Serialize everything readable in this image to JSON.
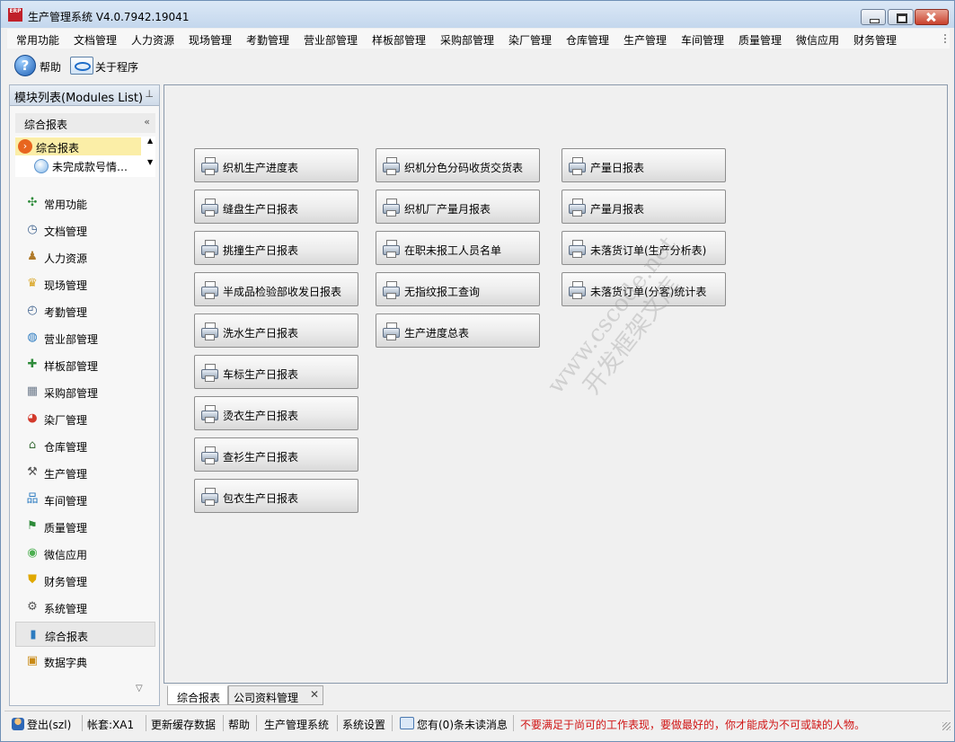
{
  "window": {
    "title": "生产管理系统 V4.0.7942.19041",
    "logo_text": "ERP"
  },
  "menu": [
    "常用功能",
    "文档管理",
    "人力资源",
    "现场管理",
    "考勤管理",
    "营业部管理",
    "样板部管理",
    "采购部管理",
    "染厂管理",
    "仓库管理",
    "生产管理",
    "车间管理",
    "质量管理",
    "微信应用",
    "财务管理"
  ],
  "toolbar": {
    "help": "帮助",
    "about": "关于程序"
  },
  "sidebar": {
    "title": "模块列表(Modules List)",
    "pin": "ᵖ",
    "group_title": "综合报表",
    "tree": [
      {
        "label": "综合报表",
        "selected": true
      },
      {
        "label": "未完成款号情…",
        "selected": false
      }
    ],
    "nav": [
      {
        "label": "常用功能",
        "icon": "expand-arrows-icon",
        "glyph": "✣",
        "color": "#2e8b3a"
      },
      {
        "label": "文档管理",
        "icon": "clock-doc-icon",
        "glyph": "◷",
        "color": "#3b5f8c"
      },
      {
        "label": "人力资源",
        "icon": "people-icon",
        "glyph": "♟",
        "color": "#b07a2a"
      },
      {
        "label": "现场管理",
        "icon": "crown-icon",
        "glyph": "♛",
        "color": "#d8a21b"
      },
      {
        "label": "考勤管理",
        "icon": "clock-icon",
        "glyph": "◴",
        "color": "#3b5f8c"
      },
      {
        "label": "营业部管理",
        "icon": "globe-icon",
        "glyph": "◍",
        "color": "#2c7bc0"
      },
      {
        "label": "样板部管理",
        "icon": "puzzle-icon",
        "glyph": "✚",
        "color": "#2e8b3a"
      },
      {
        "label": "采购部管理",
        "icon": "grid-icon",
        "glyph": "▦",
        "color": "#6e7b8c"
      },
      {
        "label": "染厂管理",
        "icon": "pie-chart-icon",
        "glyph": "◕",
        "color": "#d33a2c"
      },
      {
        "label": "仓库管理",
        "icon": "house-icon",
        "glyph": "⌂",
        "color": "#3c6e3a"
      },
      {
        "label": "生产管理",
        "icon": "wrench-icon",
        "glyph": "⚒",
        "color": "#555555"
      },
      {
        "label": "车间管理",
        "icon": "org-chart-icon",
        "glyph": "品",
        "color": "#2c7bc0"
      },
      {
        "label": "质量管理",
        "icon": "flag-icon",
        "glyph": "⚑",
        "color": "#2e8b3a"
      },
      {
        "label": "微信应用",
        "icon": "wechat-icon",
        "glyph": "◉",
        "color": "#4caf50"
      },
      {
        "label": "财务管理",
        "icon": "shield-icon",
        "glyph": "⛊",
        "color": "#e0a800"
      },
      {
        "label": "系统管理",
        "icon": "tools-icon",
        "glyph": "⚙",
        "color": "#555555"
      },
      {
        "label": "综合报表",
        "icon": "bar-chart-icon",
        "glyph": "▮",
        "color": "#2c7bc0",
        "active": true
      },
      {
        "label": "数据字典",
        "icon": "book-icon",
        "glyph": "▣",
        "color": "#c98a14"
      }
    ]
  },
  "reports": {
    "col1": [
      "织机生产进度表",
      "缝盘生产日报表",
      "挑撞生产日报表",
      "半成品检验部收发日报表",
      "洗水生产日报表",
      "车标生产日报表",
      "烫衣生产日报表",
      "查衫生产日报表",
      "包衣生产日报表"
    ],
    "col2": [
      "织机分色分码收货交货表",
      "织机厂产量月报表",
      "在职未报工人员名单",
      "无指纹报工查询",
      "生产进度总表"
    ],
    "col3": [
      "产量日报表",
      "产量月报表",
      "未落货订单(生产分析表)",
      "未落货订单(分客)统计表"
    ]
  },
  "tabs": [
    {
      "label": "综合报表",
      "active": true,
      "closable": false
    },
    {
      "label": "公司资料管理",
      "active": false,
      "closable": true
    }
  ],
  "status": {
    "logout": "登出(szl)",
    "account": "帐套:XA1",
    "refresh": "更新缓存数据",
    "help": "帮助",
    "system": "生产管理系统",
    "settings": "系统设置",
    "messages": "您有(0)条未读消息",
    "motto": "不要满足于尚可的工作表现，要做最好的，你才能成为不可或缺的人物。"
  },
  "watermark": {
    "line1": "www.cscode.net",
    "line2": "开发框架文库"
  }
}
